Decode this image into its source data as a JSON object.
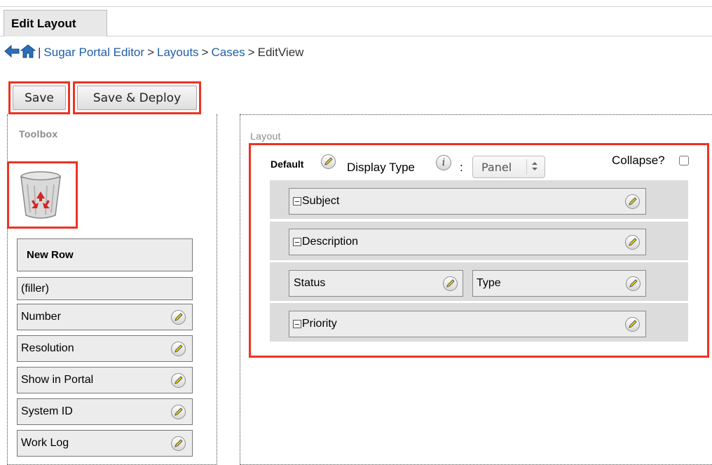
{
  "tab": {
    "label": "Edit Layout"
  },
  "breadcrumb": {
    "separator": "|",
    "items": [
      {
        "label": "Sugar Portal Editor",
        "link": true
      },
      {
        "label": "Layouts",
        "link": true
      },
      {
        "label": "Cases",
        "link": true
      },
      {
        "label": "EditView",
        "link": false
      }
    ],
    "arrow": ">"
  },
  "toolbar": {
    "save_label": "Save",
    "save_deploy_label": "Save & Deploy"
  },
  "toolbox": {
    "title": "Toolbox",
    "new_row": "New Row",
    "filler": "(filler)",
    "fields": [
      "Number",
      "Resolution",
      "Show in Portal",
      "System ID",
      "Work Log"
    ]
  },
  "layout": {
    "title": "Layout",
    "panel_name": "Default",
    "display_type_label": "Display Type",
    "colon": ":",
    "display_type_value": "Panel",
    "collapse_label": "Collapse?",
    "rows": {
      "r0": "Subject",
      "r1": "Description",
      "r2a": "Status",
      "r2b": "Type",
      "r3": "Priority"
    }
  },
  "colors": {
    "highlight": "#ee3322",
    "link": "#1f5fa6",
    "panel_gray": "#dcdcdc"
  }
}
